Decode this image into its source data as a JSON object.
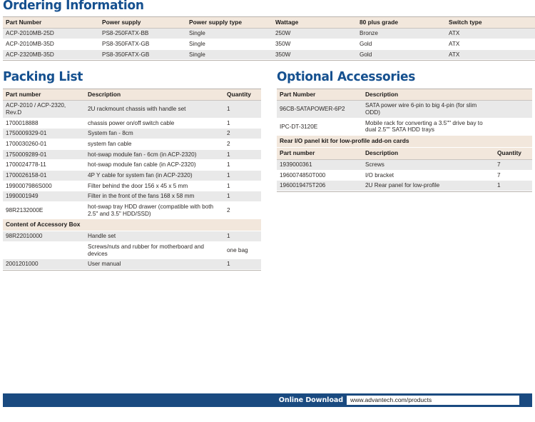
{
  "sections": {
    "ordering": {
      "heading": "Ordering Information",
      "columns": [
        "Part Number",
        "Power supply",
        "Power supply type",
        "Wattage",
        "80 plus grade",
        "Switch type"
      ],
      "rows": [
        [
          "ACP-2010MB-25D",
          "PS8-250FATX-BB",
          "Single",
          "250W",
          "Bronze",
          "ATX"
        ],
        [
          "ACP-2010MB-35D",
          "PS8-350FATX-GB",
          "Single",
          "350W",
          "Gold",
          "ATX"
        ],
        [
          "ACP-2320MB-35D",
          "PS8-350FATX-GB",
          "Single",
          "350W",
          "Gold",
          "ATX"
        ]
      ]
    },
    "packing": {
      "heading": "Packing List",
      "columns": [
        "Part number",
        "Description",
        "Quantity"
      ],
      "rows": [
        {
          "type": "data",
          "cells": [
            "ACP-2010 / ACP-2320, Rev.D",
            "2U rackmount chassis with handle set",
            "1"
          ]
        },
        {
          "type": "data",
          "cells": [
            "1700018888",
            "chassis power on/off switch cable",
            "1"
          ]
        },
        {
          "type": "data",
          "cells": [
            "1750009329-01",
            "System fan - 8cm",
            "2"
          ]
        },
        {
          "type": "data",
          "cells": [
            "1700030260-01",
            "system fan cable",
            "2"
          ]
        },
        {
          "type": "data",
          "cells": [
            "1750009289-01",
            "hot-swap module fan - 6cm (in ACP-2320)",
            "1"
          ]
        },
        {
          "type": "data",
          "cells": [
            "1700024778-11",
            "hot-swap module fan cable (in ACP-2320)",
            "1"
          ]
        },
        {
          "type": "data",
          "cells": [
            "1700026158-01",
            "4P Y cable for system fan (in ACP-2320)",
            "1"
          ]
        },
        {
          "type": "data",
          "cells": [
            "1990007986S000",
            "Filter behind the door 156 x 45 x 5 mm",
            "1"
          ]
        },
        {
          "type": "data",
          "cells": [
            "1990001949",
            "Filter in the front of the fans 168 x 58 mm",
            "1"
          ]
        },
        {
          "type": "data",
          "cells": [
            "98R2132000E",
            "hot-swap tray HDD drawer (compatible with both 2.5\" and 3.5\" HDD/SSD)",
            "2"
          ]
        },
        {
          "type": "subhead",
          "label": "Content of Accessory Box"
        },
        {
          "type": "data",
          "cells": [
            "98R22010000",
            "Handle set",
            "1"
          ]
        },
        {
          "type": "data",
          "cells": [
            "",
            "Screws/nuts and rubber for motherboard and devices",
            "one bag"
          ]
        },
        {
          "type": "data",
          "cells": [
            "2001201000",
            "User manual",
            "1"
          ]
        }
      ]
    },
    "optional": {
      "heading": "Optional Accessories",
      "columns": [
        "Part Number",
        "Description"
      ],
      "rows": [
        {
          "type": "data",
          "cells": [
            "96CB-SATAPOWER-6P2",
            "SATA power wire 6-pin to big 4-pin (for slim ODD)",
            ""
          ]
        },
        {
          "type": "data",
          "cells": [
            "IPC-DT-3120E",
            "Mobile rack for converting a 3.5\"\" drive bay to dual 2.5\"\" SATA HDD trays",
            ""
          ]
        },
        {
          "type": "subhead",
          "label": "Rear I/O panel kit for low-profile add-on cards"
        },
        {
          "type": "subhead-cols",
          "cells": [
            "Part number",
            "Description",
            "Quantity"
          ]
        },
        {
          "type": "data",
          "cells": [
            "1939000361",
            "Screws",
            "7"
          ]
        },
        {
          "type": "data",
          "cells": [
            "1960074850T000",
            "I/O bracket",
            "7"
          ]
        },
        {
          "type": "data",
          "cells": [
            "1960019475T206",
            "2U Rear panel for low-profile",
            "1"
          ]
        }
      ]
    }
  },
  "footer": {
    "label": "Online Download",
    "url": "www.advantech.com/products"
  },
  "colors": {
    "heading_blue": "#15508f",
    "footer_blue": "#1a4a80",
    "table_header_beige": "#f2e7dc",
    "row_alt_gray": "#e9e9e9"
  }
}
